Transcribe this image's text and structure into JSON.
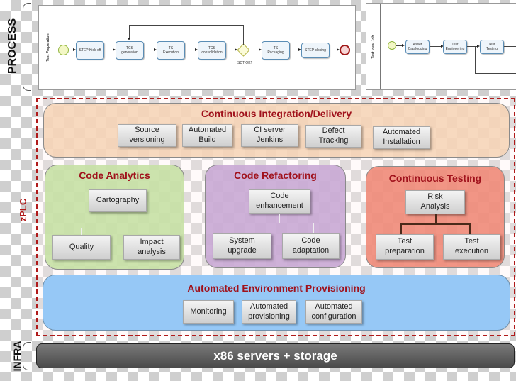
{
  "side_labels": {
    "process": "PROCESS",
    "zplc": "zPLC",
    "infra": "INFRA"
  },
  "process_left": {
    "lane": "Test Preparation",
    "tasks": [
      "STEP Kick-off",
      "TCS\ngeneration",
      "TS\nExecution",
      "TCS\nconsolidation",
      "TS\nPackaging",
      "STEP closing"
    ],
    "gateway_label": "SDT OK?"
  },
  "process_right": {
    "lane": "Test Ideal Job",
    "tasks": [
      "Asset\nCataloguing",
      "Test\nEngineering",
      "Test\nTesting"
    ]
  },
  "ci": {
    "title": "Continuous Integration/Delivery",
    "items": [
      "Source\nversioning",
      "Automated\nBuild",
      "CI server\nJenkins",
      "Defect\nTracking",
      "Automated\nInstallation"
    ]
  },
  "analytics": {
    "title": "Code Analytics",
    "root": "Cartography",
    "children": [
      "Quality",
      "Impact\nanalysis"
    ]
  },
  "refactoring": {
    "title": "Code Refactoring",
    "root": "Code\nenhancement",
    "children": [
      "System\nupgrade",
      "Code\nadaptation"
    ]
  },
  "testing": {
    "title": "Continuous Testing",
    "root": "Risk\nAnalysis",
    "children": [
      "Test\npreparation",
      "Test\nexecution"
    ]
  },
  "provisioning": {
    "title": "Automated Environment Provisioning",
    "items": [
      "Monitoring",
      "Automated\nprovisioning",
      "Automated\nconfiguration"
    ]
  },
  "infra": {
    "label": "x86 servers + storage"
  },
  "colors": {
    "accent_red": "#a0121c",
    "ci_bg": "#f6d2b4",
    "analytics_bg": "#c6e0a4",
    "refactoring_bg": "#c9a8d4",
    "testing_bg": "#f08a78",
    "provisioning_bg": "#96c8f6"
  }
}
